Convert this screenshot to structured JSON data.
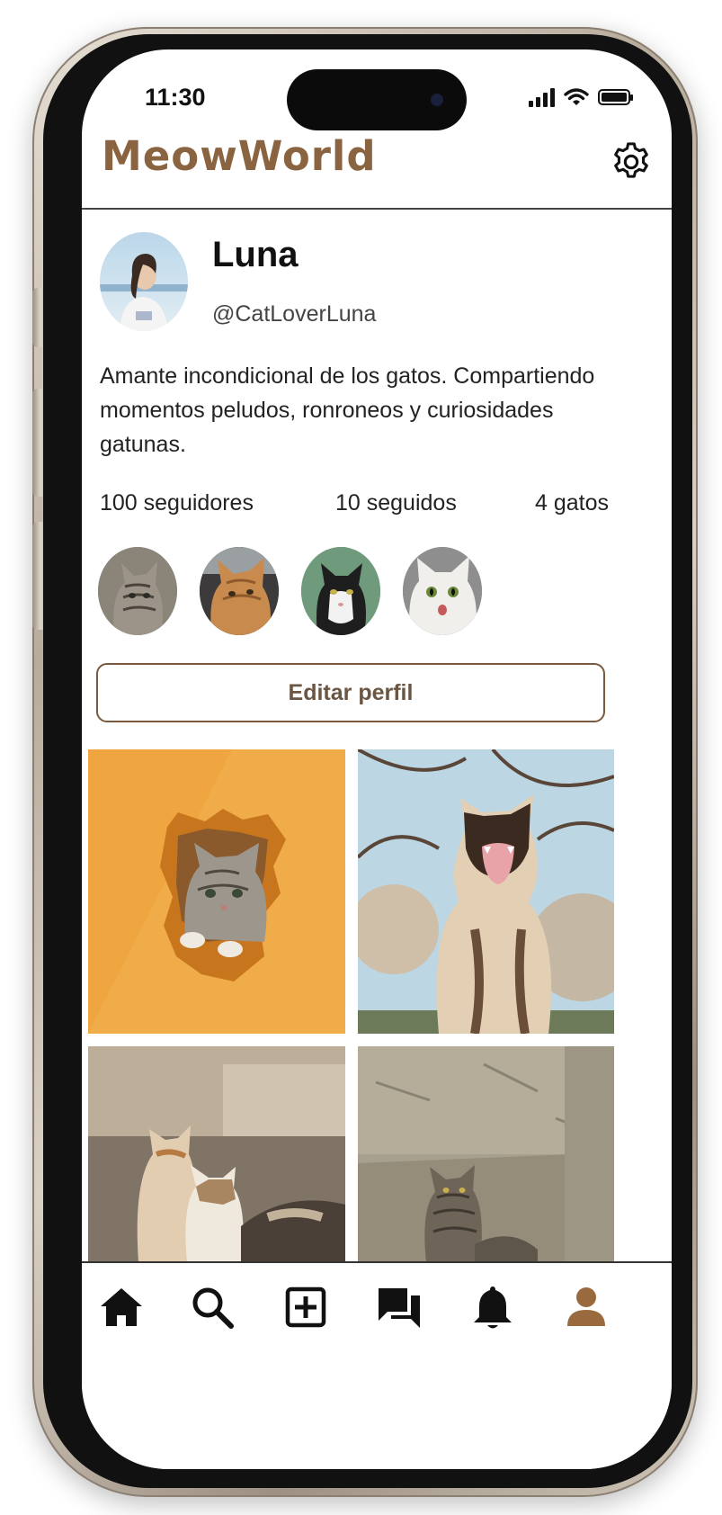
{
  "status_bar": {
    "time": "11:30"
  },
  "app": {
    "title": "MeowWorld",
    "accent": "#8a6440"
  },
  "header": {
    "settings_icon": "gear-icon"
  },
  "profile": {
    "name": "Luna",
    "handle": "@CatLoverLuna",
    "bio": "Amante incondicional de los gatos. Compartiendo momentos peludos, ronroneos y curiosidades gatunas.",
    "stats": {
      "followers": "100 seguidores",
      "following": "10 seguidos",
      "cats": "4 gatos"
    },
    "cats": [
      "tabby-kitten",
      "orange-cat",
      "tuxedo-cat",
      "white-cat"
    ],
    "edit_label": "Editar perfil"
  },
  "posts": [
    "cat-in-paper-hole",
    "siamese-yawning",
    "two-cats-street",
    "tabby-on-wall"
  ],
  "tabbar": {
    "items": [
      "home-icon",
      "search-icon",
      "add-post-icon",
      "messages-icon",
      "notifications-icon",
      "profile-icon"
    ],
    "active": "profile-icon",
    "active_color": "#9a6a3f"
  }
}
